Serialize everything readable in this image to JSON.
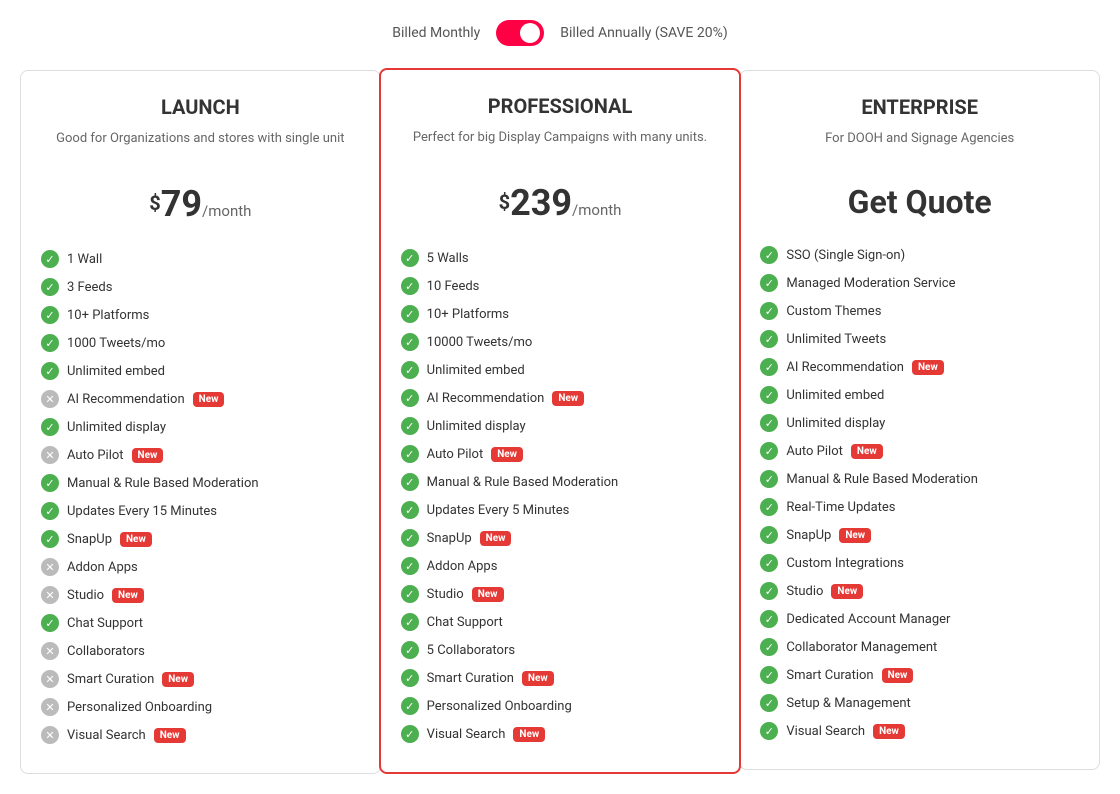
{
  "billing": {
    "monthly_label": "Billed Monthly",
    "annually_label": "Billed Annually (SAVE 20%)"
  },
  "plans": [
    {
      "id": "launch",
      "title": "LAUNCH",
      "description": "Good for Organizations and stores with single unit",
      "price": "79",
      "period": "/month",
      "currency": "$",
      "cta": null,
      "highlighted": false,
      "features": [
        {
          "text": "1 Wall",
          "enabled": true,
          "new": false
        },
        {
          "text": "3 Feeds",
          "enabled": true,
          "new": false
        },
        {
          "text": "10+ Platforms",
          "enabled": true,
          "new": false
        },
        {
          "text": "1000 Tweets/mo",
          "enabled": true,
          "new": false
        },
        {
          "text": "Unlimited embed",
          "enabled": true,
          "new": false
        },
        {
          "text": "AI Recommendation",
          "enabled": false,
          "new": true
        },
        {
          "text": "Unlimited display",
          "enabled": true,
          "new": false
        },
        {
          "text": "Auto Pilot",
          "enabled": false,
          "new": true
        },
        {
          "text": "Manual & Rule Based Moderation",
          "enabled": true,
          "new": false
        },
        {
          "text": "Updates Every 15 Minutes",
          "enabled": true,
          "new": false
        },
        {
          "text": "SnapUp",
          "enabled": true,
          "new": true
        },
        {
          "text": "Addon Apps",
          "enabled": false,
          "new": false
        },
        {
          "text": "Studio",
          "enabled": false,
          "new": true
        },
        {
          "text": "Chat Support",
          "enabled": true,
          "new": false
        },
        {
          "text": "Collaborators",
          "enabled": false,
          "new": false
        },
        {
          "text": "Smart Curation",
          "enabled": false,
          "new": true
        },
        {
          "text": "Personalized Onboarding",
          "enabled": false,
          "new": false
        },
        {
          "text": "Visual Search",
          "enabled": false,
          "new": true
        }
      ]
    },
    {
      "id": "professional",
      "title": "PROFESSIONAL",
      "description": "Perfect for big Display Campaigns with many units.",
      "price": "239",
      "period": "/month",
      "currency": "$",
      "cta": null,
      "highlighted": true,
      "features": [
        {
          "text": "5 Walls",
          "enabled": true,
          "new": false
        },
        {
          "text": "10 Feeds",
          "enabled": true,
          "new": false
        },
        {
          "text": "10+ Platforms",
          "enabled": true,
          "new": false
        },
        {
          "text": "10000 Tweets/mo",
          "enabled": true,
          "new": false
        },
        {
          "text": "Unlimited embed",
          "enabled": true,
          "new": false
        },
        {
          "text": "AI Recommendation",
          "enabled": true,
          "new": true
        },
        {
          "text": "Unlimited display",
          "enabled": true,
          "new": false
        },
        {
          "text": "Auto Pilot",
          "enabled": true,
          "new": true
        },
        {
          "text": "Manual & Rule Based Moderation",
          "enabled": true,
          "new": false
        },
        {
          "text": "Updates Every 5 Minutes",
          "enabled": true,
          "new": false
        },
        {
          "text": "SnapUp",
          "enabled": true,
          "new": true
        },
        {
          "text": "Addon Apps",
          "enabled": true,
          "new": false
        },
        {
          "text": "Studio",
          "enabled": true,
          "new": true
        },
        {
          "text": "Chat Support",
          "enabled": true,
          "new": false
        },
        {
          "text": "5 Collaborators",
          "enabled": true,
          "new": false
        },
        {
          "text": "Smart Curation",
          "enabled": true,
          "new": true
        },
        {
          "text": "Personalized Onboarding",
          "enabled": true,
          "new": false
        },
        {
          "text": "Visual Search",
          "enabled": true,
          "new": true
        }
      ]
    },
    {
      "id": "enterprise",
      "title": "ENTERPRISE",
      "description": "For DOOH and Signage Agencies",
      "price": null,
      "cta": "Get Quote",
      "highlighted": false,
      "features": [
        {
          "text": "SSO (Single Sign-on)",
          "enabled": true,
          "new": false
        },
        {
          "text": "Managed Moderation Service",
          "enabled": true,
          "new": false
        },
        {
          "text": "Custom Themes",
          "enabled": true,
          "new": false
        },
        {
          "text": "Unlimited Tweets",
          "enabled": true,
          "new": false
        },
        {
          "text": "AI Recommendation",
          "enabled": true,
          "new": true
        },
        {
          "text": "Unlimited embed",
          "enabled": true,
          "new": false
        },
        {
          "text": "Unlimited display",
          "enabled": true,
          "new": false
        },
        {
          "text": "Auto Pilot",
          "enabled": true,
          "new": true
        },
        {
          "text": "Manual & Rule Based Moderation",
          "enabled": true,
          "new": false
        },
        {
          "text": "Real-Time Updates",
          "enabled": true,
          "new": false
        },
        {
          "text": "SnapUp",
          "enabled": true,
          "new": true
        },
        {
          "text": "Custom Integrations",
          "enabled": true,
          "new": false
        },
        {
          "text": "Studio",
          "enabled": true,
          "new": true
        },
        {
          "text": "Dedicated Account Manager",
          "enabled": true,
          "new": false
        },
        {
          "text": "Collaborator Management",
          "enabled": true,
          "new": false
        },
        {
          "text": "Smart Curation",
          "enabled": true,
          "new": true
        },
        {
          "text": "Setup & Management",
          "enabled": true,
          "new": false
        },
        {
          "text": "Visual Search",
          "enabled": true,
          "new": true
        }
      ]
    }
  ],
  "labels": {
    "new_badge": "New",
    "currency": "$",
    "per_month": "/month"
  }
}
